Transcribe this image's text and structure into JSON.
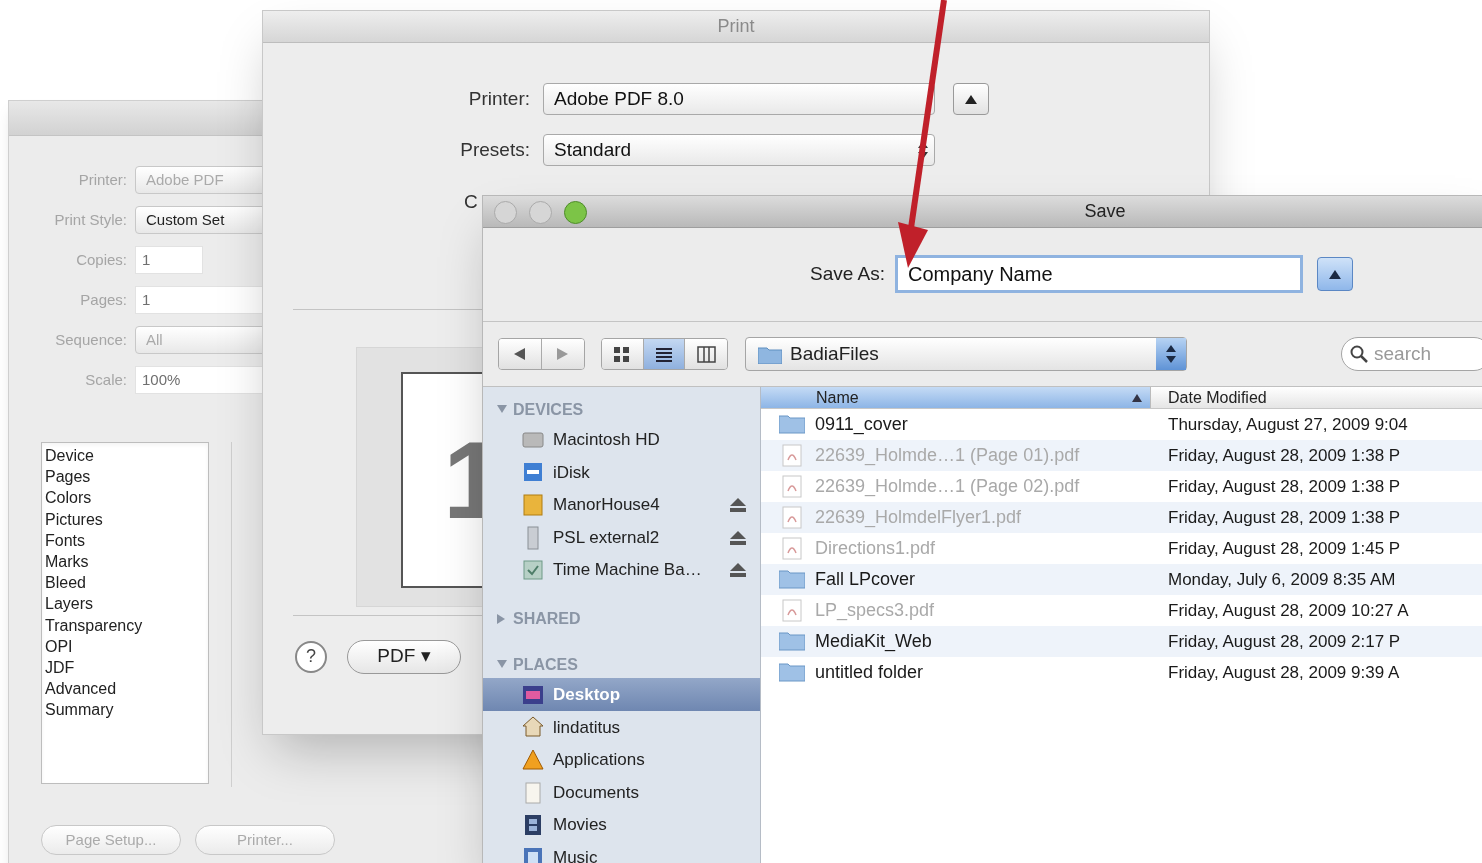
{
  "back_dialog": {
    "fields": [
      {
        "label": "Printer:",
        "value": "Adobe PDF",
        "kind": "popup"
      },
      {
        "label": "Print Style:",
        "value": "Custom Set",
        "kind": "popup"
      },
      {
        "label": "Copies:",
        "value": "1",
        "kind": "input"
      },
      {
        "label": "Pages:",
        "value": "1",
        "kind": "input"
      },
      {
        "label": "Sequence:",
        "value": "All",
        "kind": "popup"
      },
      {
        "label": "Scale:",
        "value": "100%",
        "kind": "input"
      }
    ],
    "categories": [
      "Device",
      "Pages",
      "Colors",
      "Pictures",
      "Fonts",
      "Marks",
      "Bleed",
      "Layers",
      "Transparency",
      "OPI",
      "JDF",
      "Advanced",
      "Summary"
    ],
    "buttons": [
      "Page Setup...",
      "Printer..."
    ]
  },
  "print_dialog": {
    "title": "Print",
    "printer": {
      "label": "Printer:",
      "value": "Adobe PDF 8.0"
    },
    "presets": {
      "label": "Presets:",
      "value": "Standard"
    },
    "partial_label": "C",
    "preview_page": "1",
    "help": "?",
    "pdf_button": "PDF ▾"
  },
  "save_dialog": {
    "title": "Save",
    "save_as": {
      "label": "Save As:",
      "value": "Company Name"
    },
    "location": "BadiaFiles",
    "search": {
      "placeholder": "search"
    },
    "view_modes": [
      {
        "kind": "icons",
        "selected": false
      },
      {
        "kind": "list",
        "selected": true
      },
      {
        "kind": "columns",
        "selected": false
      }
    ],
    "sidebar": [
      {
        "heading": "DEVICES",
        "expanded": true,
        "items": [
          {
            "label": "Macintosh HD",
            "kind": "drive",
            "ejectable": false,
            "selected": false
          },
          {
            "label": "iDisk",
            "kind": "idisk",
            "ejectable": false,
            "selected": false
          },
          {
            "label": "ManorHouse4",
            "kind": "volume",
            "ejectable": true,
            "selected": false
          },
          {
            "label": "PSL external2",
            "kind": "external",
            "ejectable": true,
            "selected": false
          },
          {
            "label": "Time Machine Ba…",
            "kind": "backup",
            "ejectable": true,
            "selected": false
          }
        ]
      },
      {
        "heading": "SHARED",
        "expanded": false
      },
      {
        "heading": "PLACES",
        "expanded": true,
        "items": [
          {
            "label": "Desktop",
            "kind": "desktop",
            "ejectable": false,
            "selected": true
          },
          {
            "label": "lindatitus",
            "kind": "home",
            "ejectable": false,
            "selected": false
          },
          {
            "label": "Applications",
            "kind": "applications",
            "ejectable": false,
            "selected": false
          },
          {
            "label": "Documents",
            "kind": "documents",
            "ejectable": false,
            "selected": false
          },
          {
            "label": "Movies",
            "kind": "movies",
            "ejectable": false,
            "selected": false
          },
          {
            "label": "Music",
            "kind": "music",
            "ejectable": false,
            "selected": false
          }
        ]
      }
    ],
    "columns": [
      {
        "label": "Name",
        "sorted": true
      },
      {
        "label": "Date Modified",
        "sorted": false
      }
    ],
    "rows": [
      {
        "name": "0911_cover",
        "date": "Thursday, August 27, 2009 9:04",
        "kind": "folder",
        "disabled": false
      },
      {
        "name": "22639_Holmde…1 (Page 01).pdf",
        "date": "Friday, August 28, 2009 1:38 P",
        "kind": "pdf",
        "disabled": true
      },
      {
        "name": "22639_Holmde…1 (Page 02).pdf",
        "date": "Friday, August 28, 2009 1:38 P",
        "kind": "pdf",
        "disabled": true
      },
      {
        "name": "22639_HolmdelFlyer1.pdf",
        "date": "Friday, August 28, 2009 1:38 P",
        "kind": "pdf",
        "disabled": true
      },
      {
        "name": "Directions1.pdf",
        "date": "Friday, August 28, 2009 1:45 P",
        "kind": "pdf",
        "disabled": true
      },
      {
        "name": "Fall LPcover",
        "date": "Monday, July 6, 2009 8:35 AM",
        "kind": "folder",
        "disabled": false
      },
      {
        "name": "LP_specs3.pdf",
        "date": "Friday, August 28, 2009 10:27 A",
        "kind": "pdf",
        "disabled": true
      },
      {
        "name": "MediaKit_Web",
        "date": "Friday, August 28, 2009 2:17 P",
        "kind": "folder",
        "disabled": false
      },
      {
        "name": "untitled folder",
        "date": "Friday, August 28, 2009 9:39 A",
        "kind": "folder",
        "disabled": false
      }
    ]
  }
}
